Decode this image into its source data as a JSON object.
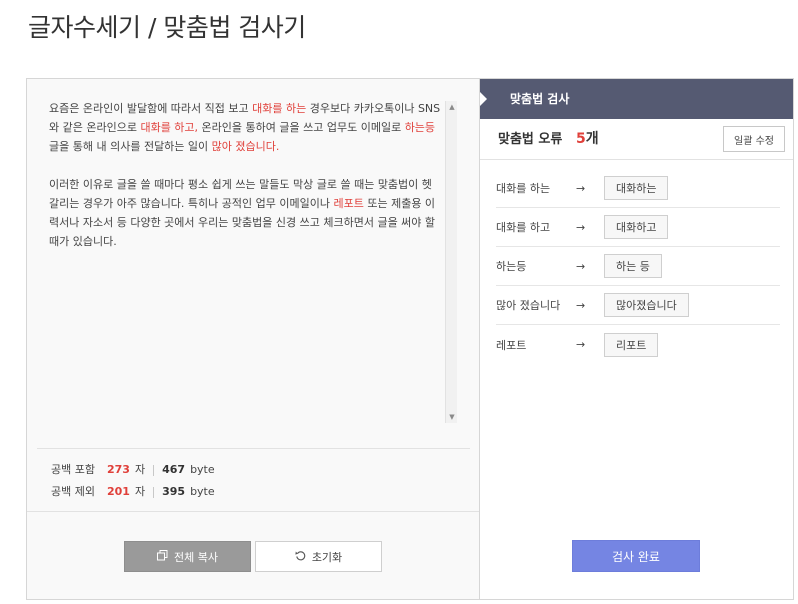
{
  "page": {
    "title": "글자수세기 / 맞춤법 검사기"
  },
  "editor": {
    "paragraph1": [
      {
        "text": "요즘은 온라인이 발달함에 따라서 직접 보고 ",
        "error": false
      },
      {
        "text": "대화를 하는",
        "error": true
      },
      {
        "text": " 경우보다 카카오톡이나 SNS와 같은 온라인으로 ",
        "error": false
      },
      {
        "text": "대화를 하고,",
        "error": true
      },
      {
        "text": " 온라인을 통하여 글을 쓰고 업무도 이메일로 ",
        "error": false
      },
      {
        "text": "하는등",
        "error": true
      },
      {
        "text": " 글을 통해 내 의사를 전달하는 일이 ",
        "error": false
      },
      {
        "text": "많아 졌습니다.",
        "error": true
      }
    ],
    "paragraph2": [
      {
        "text": "이러한 이유로 글을 쓸 때마다 평소 쉽게 쓰는 말들도 막상 글로 쓸 때는 맞춤법이 헷갈리는 경우가 아주 많습니다. 특히나 공적인 업무 이메일이나 ",
        "error": false
      },
      {
        "text": "레포트",
        "error": true
      },
      {
        "text": " 또는 제출용 이력서나 자소서 등 다양한 곳에서 우리는 맞춤법을 신경 쓰고 체크하면서 글을 써야 할 때가 있습니다.",
        "error": false
      }
    ],
    "scroll_up": "▲",
    "scroll_down": "▼"
  },
  "counts": {
    "with_space": {
      "label": "공백 포함",
      "chars": "273",
      "unit": "자",
      "bytes": "467",
      "byte_unit": "byte"
    },
    "without_space": {
      "label": "공백 제외",
      "chars": "201",
      "unit": "자",
      "bytes": "395",
      "byte_unit": "byte"
    }
  },
  "buttons": {
    "copy_all": "전체 복사",
    "copy_icon": "copy-icon",
    "reset": "초기화",
    "reset_icon": "undo-icon",
    "fix_all": "일괄 수정",
    "done": "검사 완료"
  },
  "spell_panel": {
    "title": "맞춤법 검사",
    "error_label": "맞춤법 오류",
    "error_count": "5",
    "error_unit": "개",
    "arrow": "→",
    "corrections": [
      {
        "original": "대화를 하는",
        "suggestion": "대화하는"
      },
      {
        "original": "대화를 하고",
        "suggestion": "대화하고"
      },
      {
        "original": "하는등",
        "suggestion": "하는 등"
      },
      {
        "original": "많아 졌습니다",
        "suggestion": "많아졌습니다"
      },
      {
        "original": "레포트",
        "suggestion": "리포트"
      }
    ]
  },
  "colors": {
    "accent_red": "#e0403a",
    "header_bg": "#555a72",
    "done_button": "#7585e3",
    "copy_button": "#9a9a9a"
  }
}
